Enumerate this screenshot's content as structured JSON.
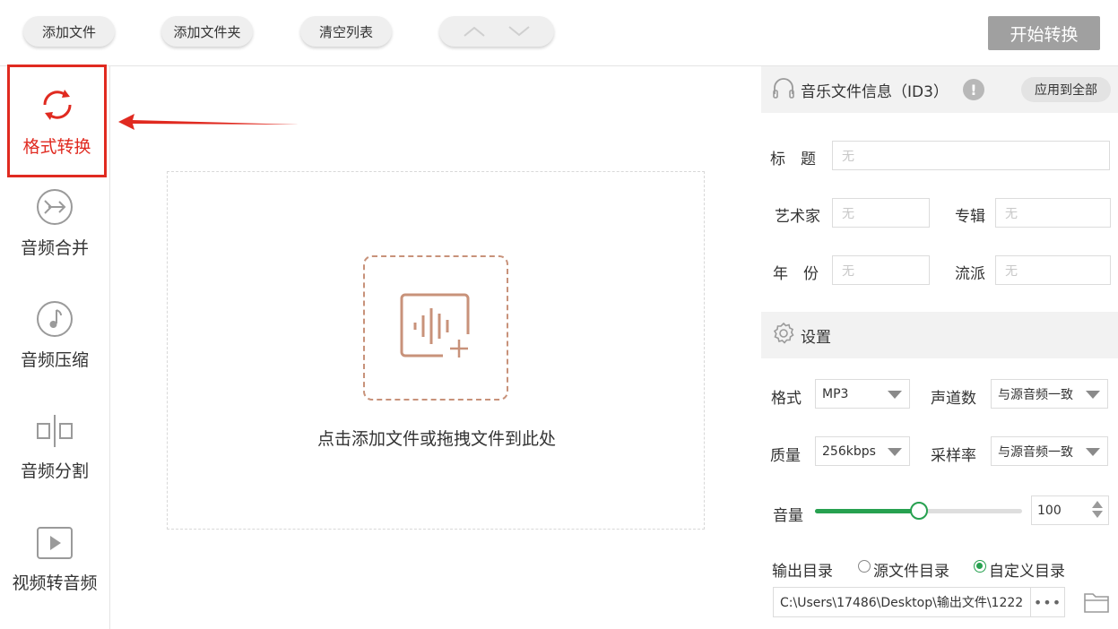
{
  "toolbar": {
    "add_file": "添加文件",
    "add_folder": "添加文件夹",
    "clear_list": "清空列表",
    "start": "开始转换"
  },
  "sidebar": {
    "items": [
      {
        "label": "格式转换",
        "icon": "refresh-icon",
        "active": true
      },
      {
        "label": "音频合并",
        "icon": "merge-icon"
      },
      {
        "label": "音频压缩",
        "icon": "music-note-icon"
      },
      {
        "label": "音频分割",
        "icon": "split-icon"
      },
      {
        "label": "视频转音频",
        "icon": "play-icon"
      }
    ]
  },
  "dropzone": {
    "text": "点击添加文件或拖拽文件到此处",
    "icon": "audio-add-icon"
  },
  "info_section": {
    "title": "音乐文件信息（ID3）",
    "apply_all": "应用到全部",
    "title_label": "标　题",
    "title_placeholder": "无",
    "artist_label": "艺术家",
    "artist_placeholder": "无",
    "album_label": "专辑",
    "album_placeholder": "无",
    "year_label": "年　份",
    "year_placeholder": "无",
    "genre_label": "流派",
    "genre_placeholder": "无"
  },
  "settings": {
    "title": "设置",
    "format_label": "格式",
    "format_value": "MP3",
    "channels_label": "声道数",
    "channels_value": "与源音频一致",
    "quality_label": "质量",
    "quality_value": "256kbps",
    "samplerate_label": "采样率",
    "samplerate_value": "与源音频一致",
    "volume_label": "音量",
    "volume_value": "100",
    "volume_fraction": 0.5,
    "output_label": "输出目录",
    "source_dir_label": "源文件目录",
    "custom_dir_label": "自定义目录",
    "custom_selected": true,
    "output_path": "C:\\Users\\17486\\Desktop\\输出文件\\1222",
    "browse_dots": "•••"
  },
  "colors": {
    "accent_red": "#e02a20",
    "accent_green": "#27a150",
    "drop_icon": "#c8927a"
  }
}
